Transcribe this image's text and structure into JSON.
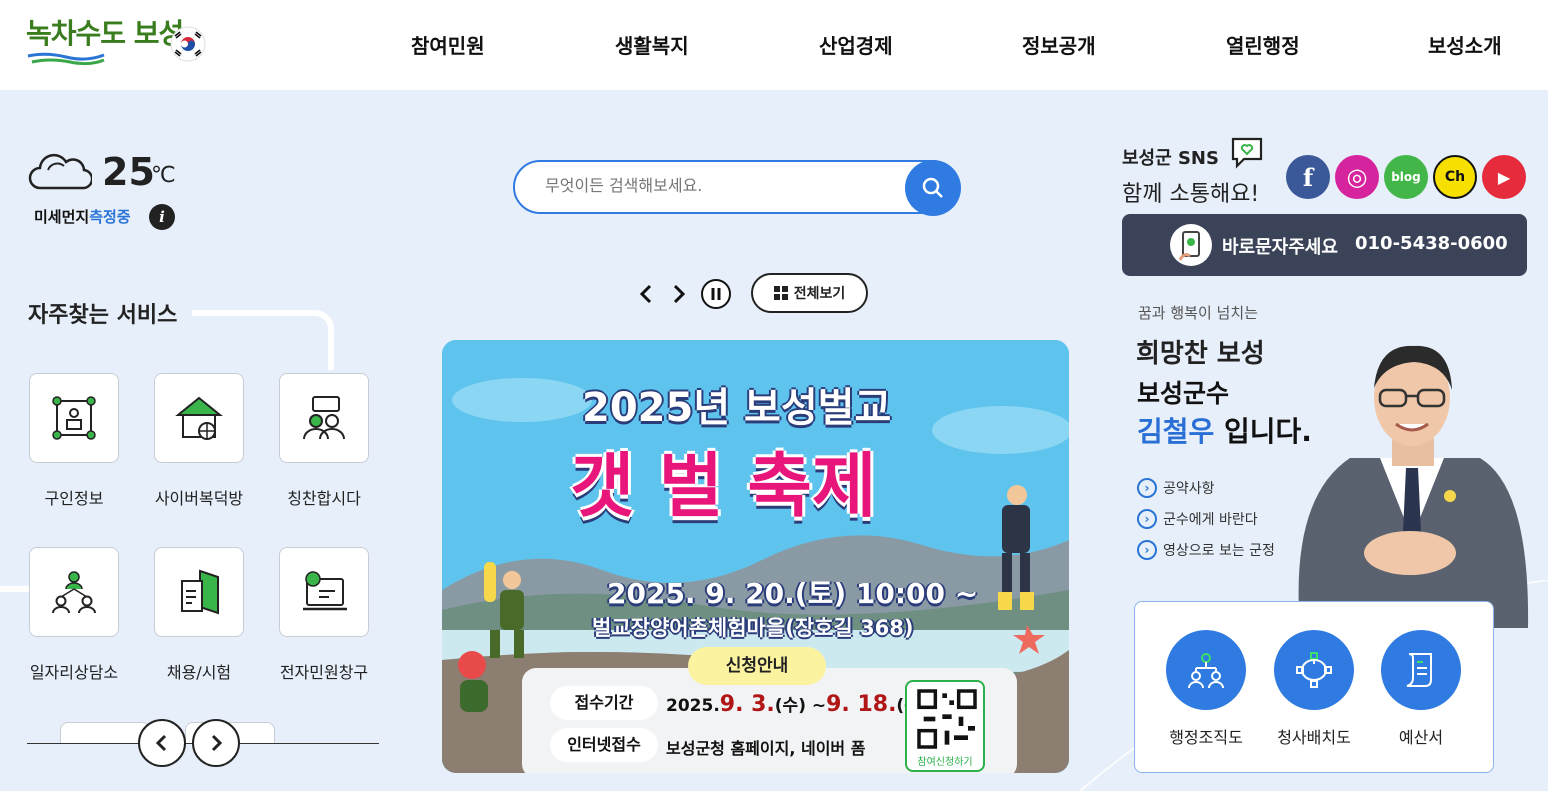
{
  "header": {
    "logo_text": "녹차수도 보성",
    "menu": [
      "참여민원",
      "생활복지",
      "산업경제",
      "정보공개",
      "열린행정",
      "보성소개"
    ]
  },
  "weather": {
    "temperature": "25",
    "unit": "℃",
    "dust_label": "미세먼지",
    "dust_status": "측정중",
    "info_icon": "i"
  },
  "search": {
    "placeholder": "무엇이든 검색해보세요."
  },
  "slider": {
    "view_all_label": "전체보기"
  },
  "banner": {
    "year_title": "2025년 보성벌교",
    "festival_title": "갯 벌 축제",
    "date": "2025. 9. 20.(토) 10:00 ~",
    "place": "벌교장양어촌체험마을(장호길 368)",
    "apply_label": "신청안내",
    "period_label": "접수기간",
    "period_prefix": "2025.",
    "period_start": "9. 3.",
    "period_start_day": "(수) ~",
    "period_end": "9. 18.",
    "period_end_day": "(목)",
    "internet_label": "인터넷접수",
    "internet_value": "보성군청 홈페이지, 네이버 폼",
    "qr_label": "참여신청하기"
  },
  "services": {
    "title": "자주찾는 서비스",
    "items": [
      {
        "label": "구인정보",
        "icon": "job-search-icon"
      },
      {
        "label": "사이버복덕방",
        "icon": "cyber-realty-icon"
      },
      {
        "label": "칭찬합시다",
        "icon": "praise-icon"
      },
      {
        "label": "일자리상담소",
        "icon": "job-counsel-icon"
      },
      {
        "label": "채용/시험",
        "icon": "recruit-exam-icon"
      },
      {
        "label": "전자민원창구",
        "icon": "e-civil-icon"
      }
    ]
  },
  "sns": {
    "title": "보성군 SNS",
    "subtitle": "함께 소통해요!",
    "items": [
      {
        "name": "facebook",
        "color": "#3b5998",
        "glyph": "f"
      },
      {
        "name": "instagram",
        "color": "#d6249f",
        "glyph": "◎"
      },
      {
        "name": "blog",
        "color": "#43b649",
        "glyph": "blog"
      },
      {
        "name": "kakao-channel",
        "color": "#f7e000",
        "glyph": "Ch"
      },
      {
        "name": "youtube",
        "color": "#e62c3c",
        "glyph": "▶"
      }
    ]
  },
  "call": {
    "label": "바로문자주세요",
    "number": "010-5438-0600"
  },
  "governor": {
    "tagline": "꿈과 행복이 넘치는",
    "slogan": "희망찬 보성",
    "line1": "보성군수",
    "name": "김철우",
    "line2_suffix": " 입니다.",
    "links": [
      "공약사항",
      "군수에게 바란다",
      "영상으로 보는 군정"
    ]
  },
  "quick": {
    "items": [
      {
        "label": "행정조직도",
        "icon": "org-chart-icon"
      },
      {
        "label": "청사배치도",
        "icon": "office-map-icon"
      },
      {
        "label": "예산서",
        "icon": "budget-doc-icon"
      }
    ]
  },
  "colors": {
    "accent": "#2f7be2",
    "background": "#e7effa",
    "call_bar": "#3b4358",
    "governor_name": "#2a6fd6"
  }
}
